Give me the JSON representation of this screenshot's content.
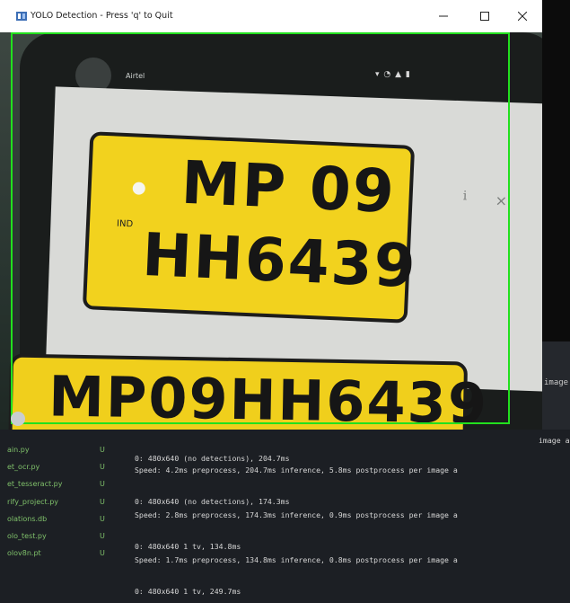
{
  "window": {
    "title": "YOLO Detection - Press 'q' to Quit",
    "minimize_icon": "minimize-icon",
    "maximize_icon": "maximize-icon",
    "close_icon": "close-icon"
  },
  "video": {
    "status_bar_text": "Airtel",
    "plate_main_line1": "MP 09",
    "plate_main_line2": "HH6439",
    "plate_ind": "IND",
    "plate_bottom": "MP09HH6439",
    "detection_box_color": "#22e01e"
  },
  "background": {
    "right_text": "image"
  },
  "explorer": {
    "files": [
      {
        "name": "ain.py",
        "status": "U"
      },
      {
        "name": "et_ocr.py",
        "status": "U"
      },
      {
        "name": "et_tesseract.py",
        "status": "U"
      },
      {
        "name": "rify_project.py",
        "status": "U"
      },
      {
        "name": "olations.db",
        "status": "U"
      },
      {
        "name": "olo_test.py",
        "status": "U"
      },
      {
        "name": "olov8n.pt",
        "status": "U"
      }
    ]
  },
  "terminal": {
    "lines": [
      "0: 480x640 (no detections), 204.7ms",
      "Speed: 4.2ms preprocess, 204.7ms inference, 5.8ms postprocess per image a",
      "0: 480x640 (no detections), 174.3ms",
      "Speed: 2.8ms preprocess, 174.3ms inference, 0.9ms postprocess per image a",
      "0: 480x640 1 tv, 134.8ms",
      "Speed: 1.7ms preprocess, 134.8ms inference, 0.8ms postprocess per image a",
      "0: 480x640 1 tv, 249.7ms"
    ],
    "top_right_fragment": "image a"
  }
}
